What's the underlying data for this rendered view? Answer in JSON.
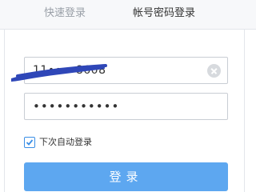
{
  "tabs": {
    "quick_login": "快速登录",
    "account_login": "帐号密码登录",
    "active": "account_login"
  },
  "form": {
    "username_value": "11••••8608",
    "username_clear_icon": "circle-x-icon",
    "password_value": "•••••••••••",
    "remember_label": "下次自动登录",
    "remember_checked": true,
    "login_button_label": "登录"
  },
  "colors": {
    "accent": "#5da7f0",
    "redaction": "#2f47b8",
    "tab_bar_bg": "#f7f8fa"
  }
}
